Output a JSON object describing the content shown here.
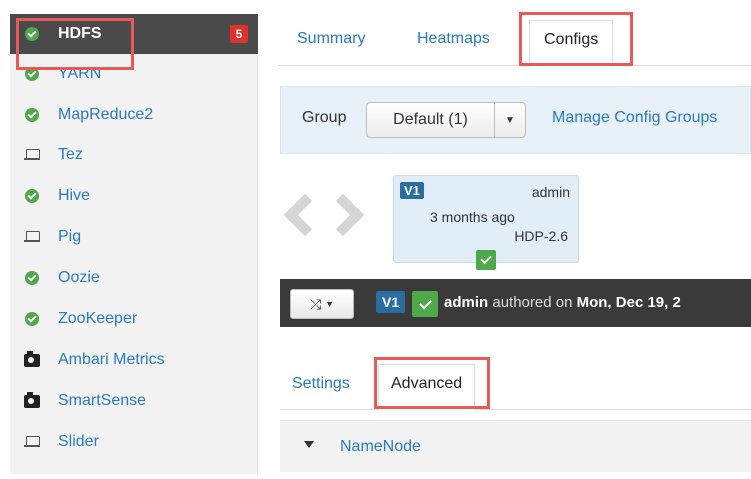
{
  "sidebar": {
    "items": [
      {
        "label": "HDFS",
        "icon": "status-ok-icon",
        "active": true,
        "badge": "5"
      },
      {
        "label": "YARN",
        "icon": "status-ok-icon"
      },
      {
        "label": "MapReduce2",
        "icon": "status-ok-icon"
      },
      {
        "label": "Tez",
        "icon": "laptop-icon"
      },
      {
        "label": "Hive",
        "icon": "status-ok-icon"
      },
      {
        "label": "Pig",
        "icon": "laptop-icon"
      },
      {
        "label": "Oozie",
        "icon": "status-ok-icon"
      },
      {
        "label": "ZooKeeper",
        "icon": "status-ok-icon"
      },
      {
        "label": "Ambari Metrics",
        "icon": "camera-icon"
      },
      {
        "label": "SmartSense",
        "icon": "camera-icon"
      },
      {
        "label": "Slider",
        "icon": "laptop-icon"
      }
    ]
  },
  "tabs": {
    "summary": "Summary",
    "heatmaps": "Heatmaps",
    "configs": "Configs"
  },
  "group": {
    "label": "Group",
    "selected": "Default (1)",
    "manage_link": "Manage Config Groups"
  },
  "version_card": {
    "tag": "V1",
    "author": "admin",
    "time": "3 months ago",
    "stack": "HDP-2.6"
  },
  "version_bar": {
    "tag": "V1",
    "author": "admin",
    "authored_text": "authored on",
    "date": "Mon, Dec 19, 2"
  },
  "subtabs": {
    "settings": "Settings",
    "advanced": "Advanced"
  },
  "section": {
    "namenode": "NameNode"
  },
  "colors": {
    "link": "#2a7bc4",
    "ok_green": "#4fa84a",
    "badge_red": "#e0302e",
    "highlight": "#e85a5a",
    "active_bg": "#4a4a4a"
  }
}
